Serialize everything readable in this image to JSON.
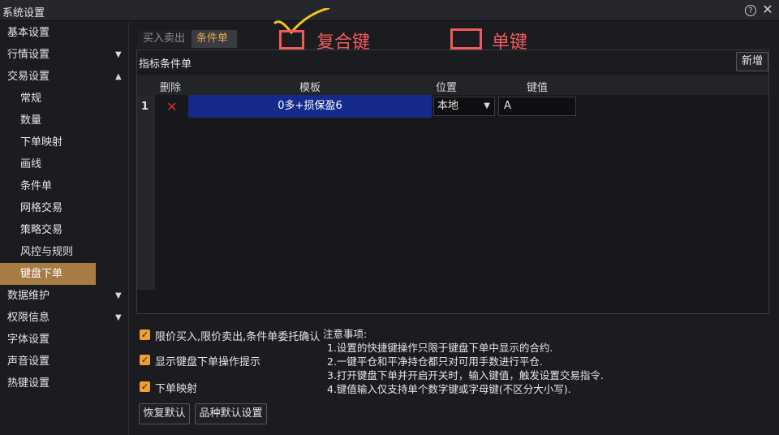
{
  "window": {
    "title": "系统设置"
  },
  "sidebar": {
    "items": [
      {
        "label": "基本设置",
        "level": "top",
        "arrow": ""
      },
      {
        "label": "行情设置",
        "level": "top",
        "arrow": "▼"
      },
      {
        "label": "交易设置",
        "level": "top",
        "arrow": "▲"
      },
      {
        "label": "常规",
        "level": "sub",
        "arrow": ""
      },
      {
        "label": "数量",
        "level": "sub",
        "arrow": ""
      },
      {
        "label": "下单映射",
        "level": "sub",
        "arrow": ""
      },
      {
        "label": "画线",
        "level": "sub",
        "arrow": ""
      },
      {
        "label": "条件单",
        "level": "sub",
        "arrow": ""
      },
      {
        "label": "网格交易",
        "level": "sub",
        "arrow": ""
      },
      {
        "label": "策略交易",
        "level": "sub",
        "arrow": ""
      },
      {
        "label": "风控与规则",
        "level": "sub",
        "arrow": ""
      },
      {
        "label": "键盘下单",
        "level": "sub",
        "arrow": "",
        "active": true
      },
      {
        "label": "数据维护",
        "level": "top",
        "arrow": "▼"
      },
      {
        "label": "权限信息",
        "level": "top",
        "arrow": "▼"
      },
      {
        "label": "字体设置",
        "level": "top",
        "arrow": ""
      },
      {
        "label": "声音设置",
        "level": "top",
        "arrow": ""
      },
      {
        "label": "热键设置",
        "level": "top",
        "arrow": ""
      }
    ]
  },
  "tabs": [
    {
      "label": "买入卖出",
      "active": false
    },
    {
      "label": "条件单",
      "active": true
    }
  ],
  "annotations": {
    "compound_key": "复合键",
    "single_key": "单键",
    "color": "#f25a5a"
  },
  "panel": {
    "title": "指标条件单",
    "add_button": "新增",
    "columns": [
      "删除",
      "模板",
      "位置",
      "键值"
    ],
    "rows": [
      {
        "index": "1",
        "delete_icon": "✕",
        "template": "0多+损保盈6",
        "position": "本地",
        "key": "A"
      }
    ]
  },
  "options": [
    {
      "label": "限价买入,限价卖出,条件单委托确认",
      "checked": true
    },
    {
      "label": "显示键盘下单操作提示",
      "checked": true
    },
    {
      "label": "下单映射",
      "checked": true
    }
  ],
  "notes": {
    "title": "注意事项:",
    "items": [
      "1.设置的快捷键操作只限于键盘下单中显示的合约.",
      "2.一键平仓和平净持仓都只对可用手数进行平仓.",
      "3.打开键盘下单并开启开关时，输入键值，触发设置交易指令.",
      "4.键值输入仅支持单个数字键或字母键(不区分大小写)."
    ]
  },
  "buttons": {
    "restore_default": "恢复默认",
    "variety_default": "品种默认设置"
  },
  "colors": {
    "accent": "#a67c44",
    "tab_active_text": "#e5a94a",
    "selected_cell": "#152a8a",
    "checkbox": "#f0a030",
    "delete": "#e02b2b"
  }
}
